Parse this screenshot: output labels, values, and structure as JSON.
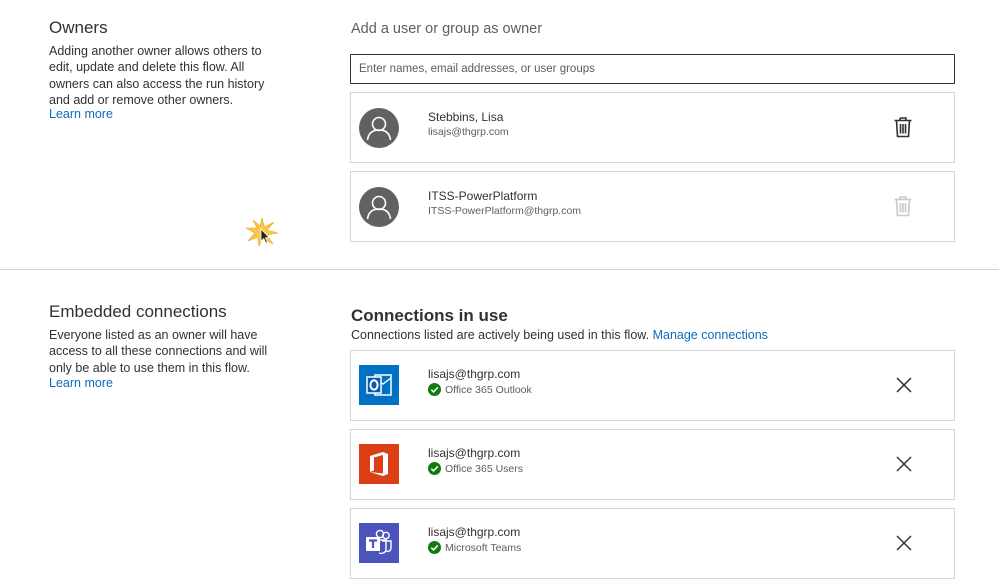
{
  "owners": {
    "title": "Owners",
    "description": "Adding another owner allows others to edit, update and delete this flow. All owners can also access the run history and add or remove other owners.",
    "learn_more": "Learn more",
    "add_label": "Add a user or group as owner",
    "search_placeholder": "Enter names, email addresses, or user groups",
    "list": [
      {
        "name": "Stebbins, Lisa",
        "email": "lisajs@thgrp.com",
        "delete_enabled": true
      },
      {
        "name": "ITSS-PowerPlatform",
        "email": "ITSS-PowerPlatform@thgrp.com",
        "delete_enabled": false
      }
    ]
  },
  "embedded": {
    "title": "Embedded connections",
    "description": "Everyone listed as an owner will have access to all these connections and will only be able to use them in this flow.",
    "learn_more": "Learn more"
  },
  "connections": {
    "title": "Connections in use",
    "description": "Connections listed are actively being used in this flow.",
    "manage_link": "Manage connections",
    "list": [
      {
        "email": "lisajs@thgrp.com",
        "service": "Office 365 Outlook",
        "icon": "outlook-icon",
        "color": "#0072c6"
      },
      {
        "email": "lisajs@thgrp.com",
        "service": "Office 365 Users",
        "icon": "office-icon",
        "color": "#dc3e15"
      },
      {
        "email": "lisajs@thgrp.com",
        "service": "Microsoft Teams",
        "icon": "teams-icon",
        "color": "#4b53bc"
      }
    ]
  },
  "colors": {
    "link": "#0f6cbd",
    "avatar": "#616161",
    "status_ok": "#107c10",
    "trash_enabled": "#323130",
    "trash_disabled": "#c8c8c8"
  }
}
